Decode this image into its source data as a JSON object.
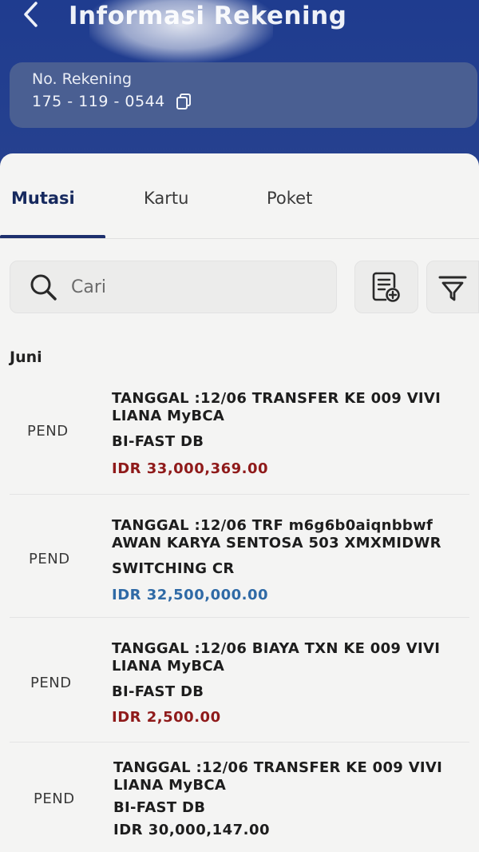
{
  "header": {
    "title": "Informasi Rekening",
    "account_label": "No. Rekening",
    "account_number": "175 - 119 - 0544"
  },
  "tabs": [
    {
      "label": "Mutasi",
      "active": true
    },
    {
      "label": "Kartu",
      "active": false
    },
    {
      "label": "Poket",
      "active": false
    }
  ],
  "search": {
    "placeholder": "Cari"
  },
  "month": "Juni",
  "transactions": [
    {
      "status": "PEND",
      "desc_line1": "TANGGAL :12/06 TRANSFER  KE 009 VIVI",
      "desc_line2": "LIANA MyBCA",
      "type": "BI-FAST DB",
      "amount": "IDR 33,000,369.00",
      "direction": "debit"
    },
    {
      "status": "PEND",
      "desc_line1": "TANGGAL :12/06 TRF m6g6b0aiqnbbwf",
      "desc_line2": "AWAN KARYA SENTOSA 503  XMXMIDWR",
      "type": "SWITCHING CR",
      "amount": "IDR 32,500,000.00",
      "direction": "credit"
    },
    {
      "status": "PEND",
      "desc_line1": "TANGGAL :12/06 BIAYA TXN  KE 009 VIVI",
      "desc_line2": "LIANA MyBCA",
      "type": "BI-FAST DB",
      "amount": "IDR 2,500.00",
      "direction": "debit"
    },
    {
      "status": "PEND",
      "desc_line1": "TANGGAL :12/06 TRANSFER  KE 009 VIVI",
      "desc_line2": "LIANA MyBCA",
      "type": "BI-FAST DB",
      "amount": "IDR 30,000,147.00",
      "direction": "debit"
    }
  ],
  "colors": {
    "header_bg": "#1f3c8f",
    "card_bg": "#4a5f92",
    "tab_active": "#16295e",
    "debit": "#8f1a1a",
    "credit": "#2f6aa6"
  },
  "icons": {
    "back": "chevron-left-icon",
    "copy": "copy-icon",
    "search": "search-icon",
    "statement": "document-add-icon",
    "filter": "filter-icon"
  }
}
